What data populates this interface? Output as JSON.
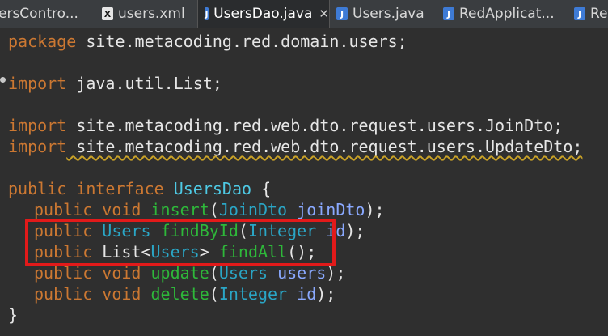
{
  "tabs": [
    {
      "label": "ersContro...",
      "icon": "",
      "active": false
    },
    {
      "label": "users.xml",
      "icon": "X",
      "active": false
    },
    {
      "label": "UsersDao.java",
      "icon": "J",
      "active": true,
      "close": "✕"
    },
    {
      "label": "Users.java",
      "icon": "J",
      "active": false
    },
    {
      "label": "RedApplicat...",
      "icon": "J",
      "active": false
    },
    {
      "label": "Res",
      "icon": "J",
      "active": false
    }
  ],
  "code": {
    "l1": [
      "package",
      " site.metacoding.red.domain.users;"
    ],
    "l2": [
      "import",
      " java.util.List;"
    ],
    "l3": [
      "import",
      " site.metacoding.red.web.dto.request.users.JoinDto;"
    ],
    "l4": [
      "import",
      " site.metacoding.red.web.dto.request.users.UpdateDto;"
    ],
    "l5": [
      "public",
      " ",
      "interface",
      " ",
      "UsersDao",
      " {"
    ],
    "l6": [
      "public",
      " ",
      "void",
      " ",
      "insert",
      "(",
      "JoinDto",
      " ",
      "joinDto",
      ");"
    ],
    "l7": [
      "public",
      " ",
      "Users",
      " ",
      "findById",
      "(",
      "Integer",
      " ",
      "id",
      ");"
    ],
    "l8": [
      "public",
      " ",
      "List",
      "<",
      "Users",
      "> ",
      "findAll",
      "();"
    ],
    "l9": [
      "public",
      " ",
      "void",
      " ",
      "update",
      "(",
      "Users",
      " ",
      "users",
      ");"
    ],
    "l10": [
      "public",
      " ",
      "void",
      " ",
      "delete",
      "(",
      "Integer",
      " ",
      "id",
      ");"
    ],
    "l11": [
      "}"
    ]
  },
  "colors": {
    "keyword": "#cc7832",
    "type": "#2aa6c6",
    "method": "#2eb83a",
    "param": "#8aa9ff",
    "highlight_box": "#e21a1a"
  }
}
